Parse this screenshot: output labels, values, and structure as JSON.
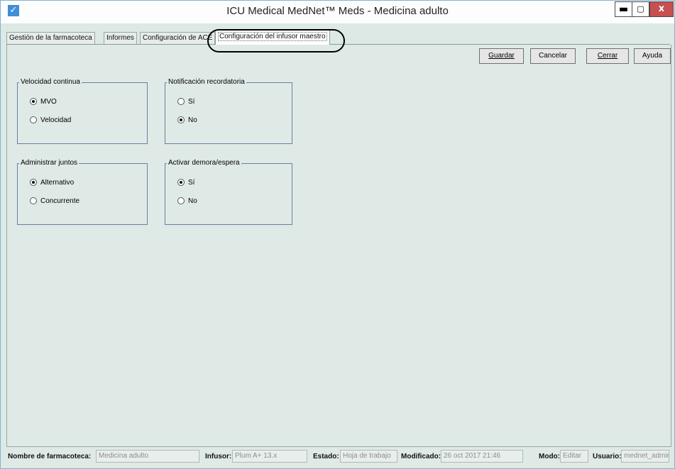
{
  "window": {
    "title": "ICU Medical MedNet™ Meds - Medicina adulto",
    "app_icon": "checkmark-icon",
    "controls": {
      "minimize": "▬",
      "maximize": "▢",
      "close": "x"
    }
  },
  "tabs": [
    {
      "label": "Gestión de la farmacoteca",
      "active": false
    },
    {
      "label": "Informes",
      "active": false
    },
    {
      "label": "Configuración de ACE",
      "active": false
    },
    {
      "label": "Configuración del infusor maestro",
      "active": true
    }
  ],
  "actions": {
    "save": "Guardar",
    "cancel": "Cancelar",
    "close": "Cerrar",
    "help": "Ayuda"
  },
  "groups": {
    "continuous_rate": {
      "title": "Velocidad continua",
      "options": [
        {
          "label": "MVO",
          "selected": true
        },
        {
          "label": "Velocidad",
          "selected": false
        }
      ]
    },
    "reminder": {
      "title": "Notificación recordatoria",
      "options": [
        {
          "label": "Sí",
          "selected": false
        },
        {
          "label": "No",
          "selected": true
        }
      ]
    },
    "administer_together": {
      "title": "Administrar juntos",
      "options": [
        {
          "label": "Alternativo",
          "selected": true
        },
        {
          "label": "Concurrente",
          "selected": false
        }
      ]
    },
    "delay_standby": {
      "title": "Activar demora/espera",
      "options": [
        {
          "label": "Sí",
          "selected": true
        },
        {
          "label": "No",
          "selected": false
        }
      ]
    }
  },
  "status": {
    "library_label": "Nombre de farmacoteca:",
    "library_value": "Medicina adulto",
    "infuser_label": "Infusor:",
    "infuser_value": "Plum A+ 13.x",
    "state_label": "Estado:",
    "state_value": "Hoja de trabajo",
    "modified_label": "Modificado:",
    "modified_value": "26 oct 2017 21:46",
    "mode_label": "Modo:",
    "mode_value": "Editar",
    "user_label": "Usuario:",
    "user_value": "mednet_admin"
  }
}
